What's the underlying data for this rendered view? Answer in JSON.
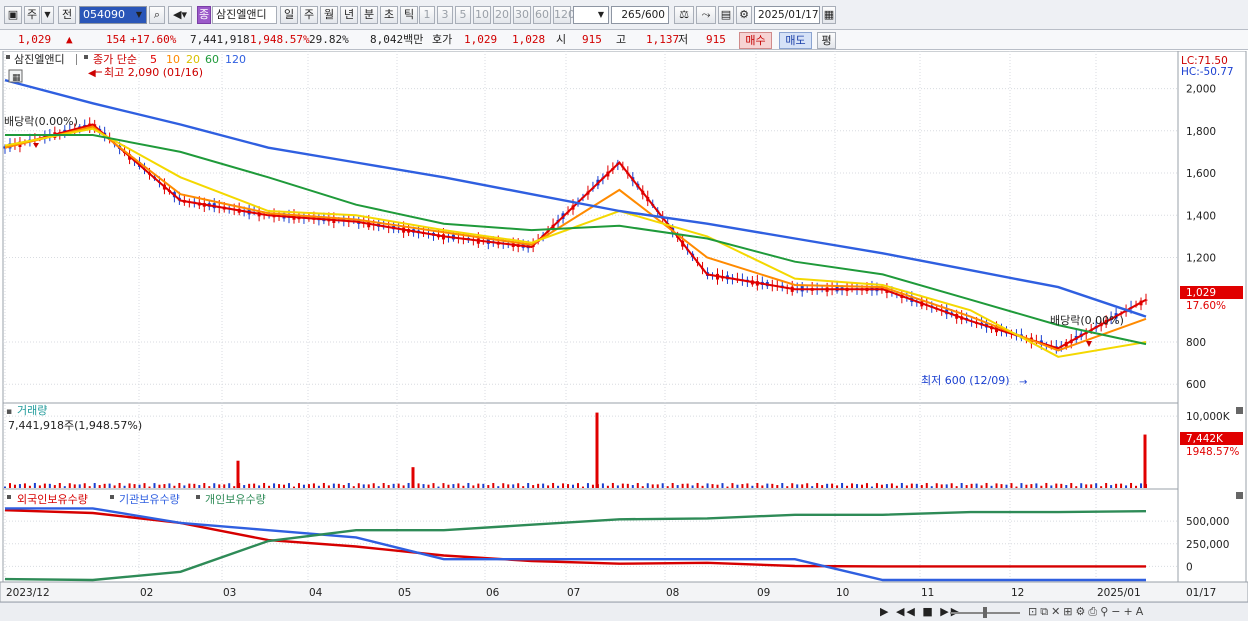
{
  "toolbar": {
    "period_prefix": "주",
    "prev_label": "전",
    "code": "054090",
    "stock_name": "삼진엘앤디",
    "name_tag": "종",
    "intervals": [
      "일",
      "주",
      "월",
      "년",
      "분",
      "초",
      "틱"
    ],
    "active_interval": "일",
    "multipliers": [
      "1",
      "3",
      "5",
      "10",
      "20",
      "30",
      "60",
      "120"
    ],
    "count": "265",
    "count_total": "/600",
    "date": "2025/01/17"
  },
  "info": {
    "price": "1,029",
    "arrow": "▲",
    "change": "154",
    "change_pct": "+17.60%",
    "volume": "7,441,918",
    "volume_pct": "1,948.57%",
    "turnover_pct": "29.82%",
    "amount": "8,042백만",
    "quote_label": "호가",
    "bid": "1,029",
    "ask": "1,028",
    "open_label": "시",
    "open": "915",
    "high_label": "고",
    "high": "1,137",
    "low_label": "저",
    "low": "915",
    "buy_label": "매수",
    "sell_label": "매도",
    "eval_label": "평"
  },
  "chart": {
    "stock_label": "삼진엘앤디",
    "ma_label": "종가 단순",
    "ma_periods": [
      "5",
      "10",
      "20",
      "60",
      "120"
    ],
    "lc": "LC:71.50",
    "hc": "HC:-50.77",
    "high_annot": "최고 2,090 (01/16)",
    "low_annot": "최저 600 (12/09)",
    "div_annot_left": "배당락(0.00%)",
    "div_annot_right": "배당락(0.00%)",
    "price_box": "1,029",
    "price_pct": "17.60%",
    "volume_title": "거래량",
    "volume_value": "7,441,918주(1,948.57%)",
    "volume_box": "7,442K",
    "volume_pct": "1948.57%",
    "holdings": [
      "외국인보유수량",
      "기관보유수량",
      "개인보유수량"
    ],
    "x_labels": [
      "2023/12",
      "02",
      "03",
      "04",
      "05",
      "06",
      "07",
      "08",
      "09",
      "10",
      "11",
      "12",
      "2025/01"
    ],
    "x_right": "01/17"
  },
  "colors": {
    "up": "#e00000",
    "down": "#1a3fd0",
    "ma5": "#e00000",
    "ma10": "#ff8a00",
    "ma20": "#f4d800",
    "ma60": "#1f9a3a",
    "ma120": "#2f5fe0",
    "foreign": "#d60000",
    "institution": "#2f5fe0",
    "individual": "#2e8b57"
  },
  "chart_data": {
    "type": "line",
    "title": "삼진엘앤디",
    "x": [
      "2023/12",
      "02",
      "03",
      "04",
      "05",
      "06",
      "07",
      "08",
      "09",
      "10",
      "11",
      "12",
      "2025/01"
    ],
    "price_axis": {
      "ticks": [
        "2,000",
        "1,800",
        "1,600",
        "1,400",
        "1,200",
        "800",
        "600"
      ],
      "ylim": [
        530,
        2140
      ]
    },
    "series": [
      {
        "name": "5",
        "values": [
          1720,
          1830,
          1470,
          1400,
          1370,
          1300,
          1250,
          1650,
          1120,
          1050,
          1050,
          900,
          770,
          1000
        ]
      },
      {
        "name": "10",
        "values": [
          1720,
          1820,
          1500,
          1410,
          1380,
          1320,
          1260,
          1520,
          1200,
          1070,
          1060,
          920,
          760,
          910
        ]
      },
      {
        "name": "20",
        "values": [
          1730,
          1810,
          1580,
          1420,
          1400,
          1330,
          1270,
          1420,
          1300,
          1100,
          1070,
          950,
          730,
          800
        ]
      },
      {
        "name": "60",
        "values": [
          1780,
          1780,
          1700,
          1580,
          1450,
          1360,
          1330,
          1350,
          1290,
          1180,
          1120,
          1000,
          880,
          790
        ]
      },
      {
        "name": "120",
        "values": [
          2040,
          1930,
          1830,
          1720,
          1650,
          1580,
          1500,
          1420,
          1360,
          1290,
          1220,
          1140,
          1060,
          920
        ]
      }
    ],
    "volume_axis": {
      "ticks": [
        "10,000K"
      ],
      "ylim": [
        0,
        11000
      ]
    },
    "volume_spikes": [
      {
        "x": "03",
        "value": 3800
      },
      {
        "x": "05",
        "value": 2900
      },
      {
        "x": "07",
        "value": 10500
      },
      {
        "x": "2025/01",
        "value": 7442
      }
    ],
    "holdings_axis": {
      "ticks": [
        "500,000",
        "250,000",
        "0"
      ],
      "ylim": [
        -150000,
        700000
      ]
    },
    "holdings_series": [
      {
        "name": "외국인보유수량",
        "values": [
          620000,
          590000,
          480000,
          290000,
          220000,
          120000,
          60000,
          30000,
          40000,
          5000,
          0,
          0,
          0,
          0
        ]
      },
      {
        "name": "기관보유수량",
        "values": [
          640000,
          640000,
          480000,
          400000,
          320000,
          80000,
          80000,
          80000,
          80000,
          80000,
          -150000,
          -150000,
          -150000,
          -150000
        ]
      },
      {
        "name": "개인보유수량",
        "values": [
          -140000,
          -150000,
          -60000,
          280000,
          400000,
          400000,
          460000,
          520000,
          530000,
          570000,
          570000,
          600000,
          600000,
          610000
        ]
      }
    ],
    "grid": true,
    "legend": "top-left"
  }
}
